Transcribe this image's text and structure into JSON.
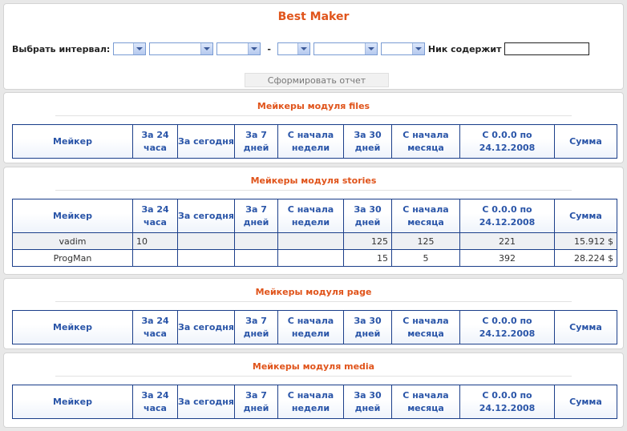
{
  "app": {
    "title": "Best Maker"
  },
  "filter": {
    "interval_label": "Выбрать интервал:",
    "dash": "-",
    "nick_label": "Ник содержит",
    "nick_value": "",
    "report_button": "Сформировать отчет"
  },
  "columns": [
    "Мейкер",
    "За 24 часа",
    "За сегодня",
    "За 7 дней",
    "С начала недели",
    "За 30 дней",
    "С начала месяца",
    "С 0.0.0 по 24.12.2008",
    "Сумма"
  ],
  "sections": [
    {
      "title": "Мейкеры модуля files",
      "rows": []
    },
    {
      "title": "Мейкеры модуля stories",
      "rows": [
        [
          "vadim",
          "10",
          "",
          "",
          "",
          "125",
          "125",
          "221",
          "15.912 $"
        ],
        [
          "ProgMan",
          "",
          "",
          "",
          "",
          "15",
          "5",
          "392",
          "28.224 $"
        ]
      ]
    },
    {
      "title": "Мейкеры модуля page",
      "rows": []
    },
    {
      "title": "Мейкеры модуля media",
      "rows": []
    }
  ]
}
